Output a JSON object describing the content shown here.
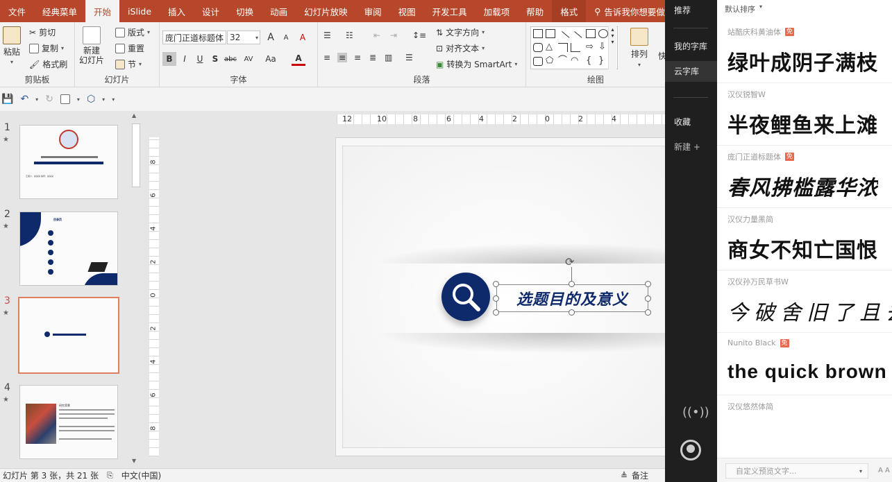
{
  "tabs": [
    "文件",
    "经典菜单",
    "开始",
    "iSlide",
    "插入",
    "设计",
    "切换",
    "动画",
    "幻灯片放映",
    "审阅",
    "视图",
    "开发工具",
    "加载项",
    "帮助",
    "格式"
  ],
  "tell_me": "告诉我你想要做什么",
  "clipboard": {
    "paste": "粘贴",
    "cut": "剪切",
    "copy": "复制",
    "format_painter": "格式刷",
    "label": "剪贴板"
  },
  "slides_group": {
    "new_slide": "新建\n幻灯片",
    "layout": "版式",
    "reset": "重置",
    "section": "节",
    "label": "幻灯片"
  },
  "font_group": {
    "font_name": "庞门正道标题体",
    "font_size": "32",
    "label": "字体",
    "bold": "B",
    "italic": "I",
    "underline": "U",
    "shadow": "S",
    "strike": "abc",
    "spacing": "AV",
    "case": "Aa",
    "color": "A",
    "grow": "A",
    "shrink": "A",
    "clear": "A"
  },
  "paragraph_group": {
    "text_direction": "文字方向",
    "align_text": "对齐文本",
    "smartart": "转换为 SmartArt",
    "label": "段落"
  },
  "drawing_group": {
    "arrange": "排列",
    "quick": "快",
    "label": "绘图"
  },
  "thumbnails": [
    {
      "num": "1",
      "star": "★",
      "subtitle": "汇报人：某某某    指导：某某某"
    },
    {
      "num": "2",
      "star": "★",
      "title": "目录页"
    },
    {
      "num": "3",
      "star": "★"
    },
    {
      "num": "4",
      "star": "★",
      "heading": "研究背景"
    }
  ],
  "ruler_h": [
    "12",
    "10",
    "8",
    "6",
    "4",
    "2",
    "0",
    "2",
    "4"
  ],
  "ruler_v": [
    "8",
    "6",
    "4",
    "2",
    "0",
    "2",
    "4",
    "6",
    "8"
  ],
  "slide_title": "选题目的及意义",
  "status": {
    "slide_info": "幻灯片 第 3 张，共 21 张",
    "language": "中文(中国)",
    "notes": "备注"
  },
  "side_nav": {
    "recommend": "推荐",
    "my_library": "我的字库",
    "cloud": "云字库",
    "favorites": "收藏",
    "new": "新建 +"
  },
  "sort": "默认排序",
  "fonts": [
    {
      "name": "站酷庆科黄油体",
      "free": "免",
      "sample": "绿叶成阴子满枝"
    },
    {
      "name": "汉仪锐智W",
      "free": "",
      "sample": "半夜鲤鱼来上滩"
    },
    {
      "name": "庞门正道标题体",
      "free": "免",
      "sample": "春风拂槛露华浓"
    },
    {
      "name": "汉仪力量黑简",
      "free": "",
      "sample": "商女不知亡国恨"
    },
    {
      "name": "汉仪孙万民草书W",
      "free": "",
      "sample": "今破舍旧了且去"
    },
    {
      "name": "Nunito Black",
      "free": "免",
      "sample": "the quick brown"
    },
    {
      "name": "汉仪悠然体简",
      "free": "",
      "sample": ""
    }
  ],
  "custom_preview": {
    "placeholder": "自定义预览文字..."
  },
  "colors": {
    "accent": "#b7472a",
    "navy": "#0f2a6b",
    "selection": "#e07f5e",
    "dark": "#1f1f1f"
  }
}
